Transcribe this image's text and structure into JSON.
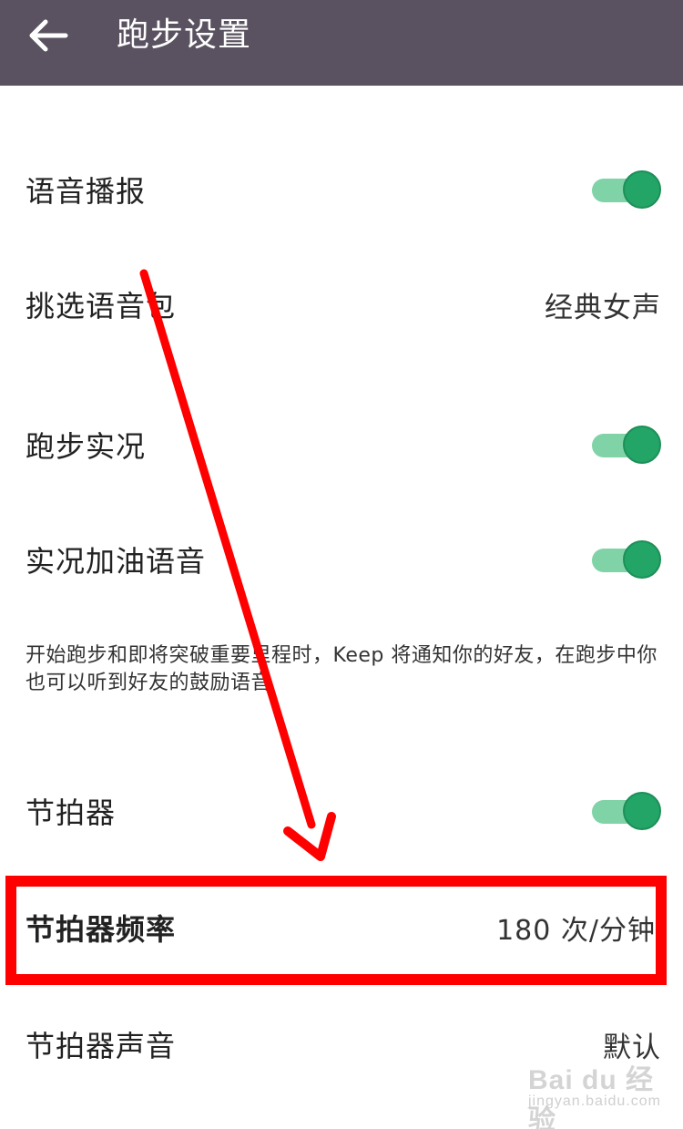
{
  "header": {
    "title": "跑步设置",
    "back_icon": "arrow-left-icon"
  },
  "settings": {
    "voice_broadcast": {
      "label": "语音播报",
      "enabled": true
    },
    "voice_pack": {
      "label": "挑选语音包",
      "value": "经典女声"
    },
    "live_running": {
      "label": "跑步实况",
      "enabled": true
    },
    "cheer_voice": {
      "label": "实况加油语音",
      "enabled": true
    },
    "cheer_description": "开始跑步和即将突破重要里程时，Keep 将通知你的好友，在跑步中你也可以听到好友的鼓励语音",
    "metronome": {
      "label": "节拍器",
      "enabled": true
    },
    "metronome_rate": {
      "label": "节拍器频率",
      "value": "180 次/分钟"
    },
    "metronome_sound": {
      "label": "节拍器声音",
      "value": "默认"
    }
  },
  "watermark": {
    "main": "Bai du 经验",
    "sub": "jingyan.baidu.com"
  },
  "colors": {
    "header_bg": "#5a5260",
    "toggle_on_knob": "#22a566",
    "toggle_on_track": "#7fd3a7",
    "annotation": "#ff0000"
  }
}
